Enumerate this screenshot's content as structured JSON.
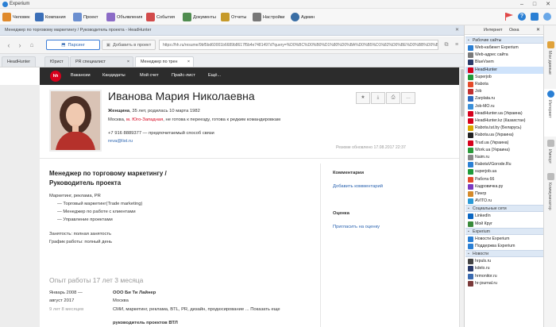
{
  "app": {
    "title": "Experium"
  },
  "toolbar": {
    "items": [
      {
        "label": "Человек",
        "color": "#e08a2c"
      },
      {
        "label": "Компания",
        "color": "#3b6fb8"
      },
      {
        "label": "Проект",
        "color": "#6b8fd0"
      },
      {
        "label": "Объявления",
        "color": "#8c6cc7"
      },
      {
        "label": "События",
        "color": "#d24b4b"
      },
      {
        "label": "Документы",
        "color": "#4f8c4f"
      },
      {
        "label": "Отчеты",
        "color": "#c69a2a"
      },
      {
        "label": "Настройки",
        "color": "#777777"
      },
      {
        "label": "Админ",
        "color": "#3a6ea5"
      }
    ]
  },
  "tabstrip": {
    "title": "Менеджер по торговому маркетингу / Руководитель проекта - HeadHunter"
  },
  "nav": {
    "parse_label": "Парсинг",
    "add_label": "Добавить в проект",
    "url": "https://hh.ru/resume/9bf5bd60001b6689b8617f5b4e7481497d?query=%D0%BC%D0%B0%D1%80%D0%BA%D0%B5%D1%82%D0%BE%D0%BB%D0%BE%D0%B3"
  },
  "browser_tabs": [
    "HeadHunter",
    "Юрист",
    "PR специалист",
    "Менеджер по трен"
  ],
  "hh": {
    "logo": "hh",
    "nav": [
      "Вакансии",
      "Кандидаты",
      "Мой счет",
      "Прайс-лист",
      "Ещё..."
    ]
  },
  "profile": {
    "name": "Иванова Мария Николаевна",
    "gender_age": "Женщина",
    "age_rest": ", 35 лет, родилась 10 марта 1982",
    "city": "Москва, ",
    "metro": "м. Юго-Западная",
    "relocate": ", не готова к переезду, готова к редким командировкам",
    "phone": "+7 916 8889377  — предпочитаемый способ связи",
    "email": "reva@list.ru",
    "updated": "Резюме обновлено 17.08.2017 22:37"
  },
  "resume": {
    "position_line1": "Менеджер по торговому маркетингу /",
    "position_line2": "Руководитель проекта",
    "specialization": "Маркетинг, реклама, PR",
    "spec_items": [
      "— Торговый маркетинг(Trade marketing)",
      "— Менеджер по работе с клиентами",
      "— Управление проектами"
    ],
    "employment": "Занятость: полная занятость",
    "schedule": "График работы: полный день",
    "experience": "Опыт работы 17 лет 3 месяца",
    "job_period_1": "Январь 2008 —",
    "job_period_2": "август 2017",
    "job_duration": "9 лет 8 месяцев",
    "job_company": "ООО Би Ти Лайнер",
    "job_city": "Москва",
    "job_tags": "СМИ, маркетинг, реклама, BTL, PR, дизайн, продюсирование ... Показать еще",
    "next_line": "руководитель проектов ВТЛ"
  },
  "side": {
    "comments_title": "Комментарии",
    "comments_link": "Добавить комментарий",
    "rating_title": "Оценка",
    "rating_link": "Пригласить на оценку"
  },
  "rightpanel": {
    "tabs": [
      "Интернет",
      "Окна"
    ],
    "groups": [
      "Рабочие сайты",
      "Социальные сети",
      "Experium",
      "Новости"
    ],
    "work_sites": [
      {
        "label": "Web-кабинет Experium",
        "color": "#2a7fd4"
      },
      {
        "label": "Web-адрес сайта",
        "color": "#7a7a7a"
      },
      {
        "label": "BlueVsem",
        "color": "#2a3a6a"
      },
      {
        "label": "HeadHunter",
        "color": "#d6001c"
      },
      {
        "label": "Superjob",
        "color": "#1f9a3a"
      },
      {
        "label": "Rabota",
        "color": "#e44a2a"
      },
      {
        "label": "Job",
        "color": "#c03030"
      },
      {
        "label": "Zarplata.ru",
        "color": "#2e6bbf"
      },
      {
        "label": "Job-MO.ru",
        "color": "#3a8fd9"
      },
      {
        "label": "HeadHunter.ua (Украина)",
        "color": "#d6001c"
      },
      {
        "label": "HeadHunter.kz (Казахстан)",
        "color": "#d6001c"
      },
      {
        "label": "Rabota.tut.by (Беларусь)",
        "color": "#d9a800"
      },
      {
        "label": "Rabota.ua (Украина)",
        "color": "#222222"
      },
      {
        "label": "Trud.ua (Украина)",
        "color": "#d6001c"
      },
      {
        "label": "Work.ua (Украина)",
        "color": "#2a9a3a"
      },
      {
        "label": "Naim.ru",
        "color": "#888888"
      },
      {
        "label": "RabotaVGorode.Ru",
        "color": "#2a7fd4"
      },
      {
        "label": "superjob.ua",
        "color": "#1f9a3a"
      },
      {
        "label": "Работа 66",
        "color": "#e44a2a"
      },
      {
        "label": "Кадровичка.ру",
        "color": "#7a3ac0"
      },
      {
        "label": "Пингр",
        "color": "#d48a2a"
      },
      {
        "label": "AVITO.ru",
        "color": "#2a9ad6"
      }
    ],
    "social": [
      {
        "label": "LinkedIn",
        "color": "#0a66c2"
      },
      {
        "label": "Мой Круг",
        "color": "#3a8a3a"
      }
    ],
    "experium": [
      {
        "label": "Новости Experium",
        "color": "#2a7fd4"
      },
      {
        "label": "Поддержка Experium",
        "color": "#2a7fd4"
      }
    ],
    "news": [
      {
        "label": "hrpuls.ru",
        "color": "#444444"
      },
      {
        "label": "kdelo.ru",
        "color": "#2a3a6a"
      },
      {
        "label": "hrmonitor.ru",
        "color": "#3a6ab0"
      },
      {
        "label": "hr-journal.ru",
        "color": "#7a3a3a"
      }
    ]
  },
  "vtabs": [
    "Мои данные",
    "Интернет",
    "Импорт",
    "Коммуникатор"
  ]
}
